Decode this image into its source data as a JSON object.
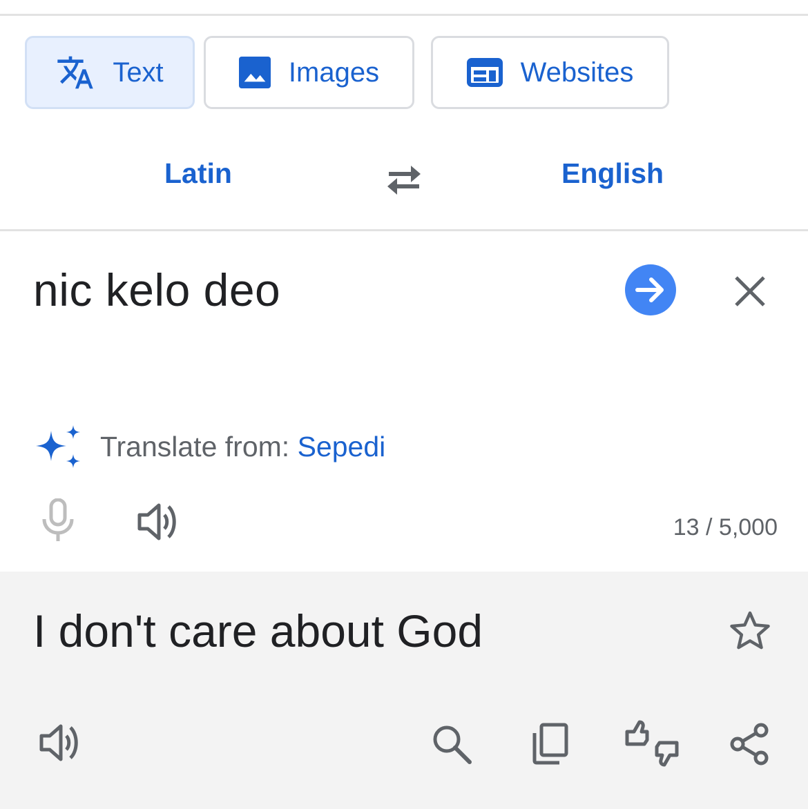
{
  "modes": [
    {
      "label": "Text",
      "icon": "translate-icon",
      "active": true
    },
    {
      "label": "Images",
      "icon": "image-icon",
      "active": false
    },
    {
      "label": "Websites",
      "icon": "web-icon",
      "active": false
    }
  ],
  "languages": {
    "source": "Latin",
    "target": "English",
    "swap_icon": "swap-arrows-icon"
  },
  "input": {
    "text": "nic kelo deo",
    "char_count": "13 / 5,000",
    "suggestion_prefix": "Translate from: ",
    "suggestion_language": "Sepedi"
  },
  "output": {
    "text": "I don't care about God"
  },
  "colors": {
    "accent": "#1a62cf",
    "action_blue": "#4285f4",
    "output_bg": "#f3f3f3",
    "icon_gray": "#5f6368"
  }
}
